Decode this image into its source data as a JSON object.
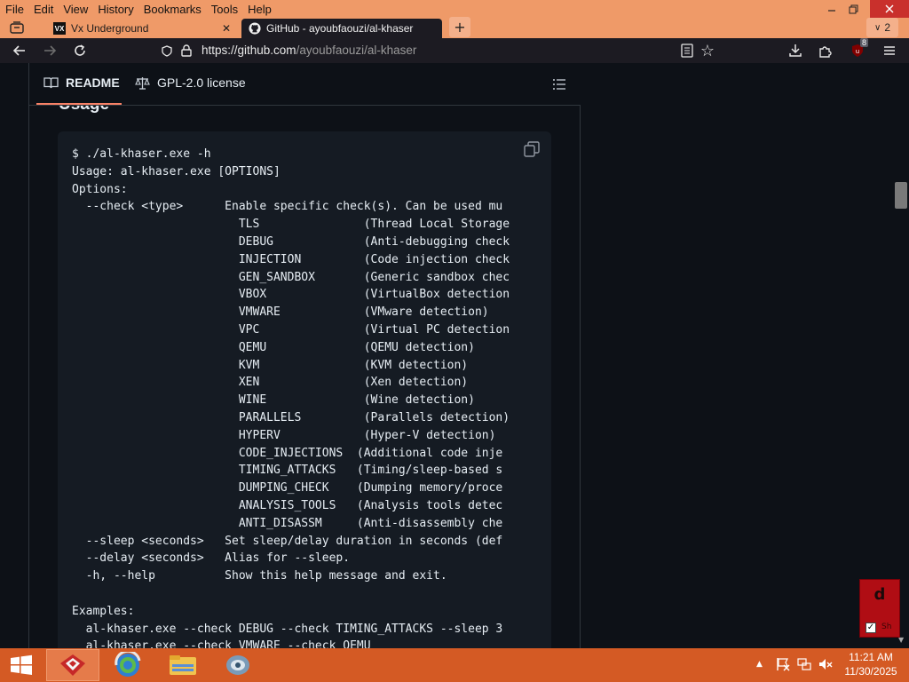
{
  "menu": [
    "File",
    "Edit",
    "View",
    "History",
    "Bookmarks",
    "Tools",
    "Help"
  ],
  "tabs": [
    {
      "title": "Vx Underground",
      "favicon": "VX"
    },
    {
      "title": "GitHub - ayoubfaouzi/al-khaser",
      "favicon": "github-icon"
    }
  ],
  "tab_count": "2",
  "address": {
    "host": "https://github.com",
    "path": "/ayoubfaouzi/al-khaser"
  },
  "extension_badge": "8",
  "readme_tabs": {
    "readme": "README",
    "license": "GPL-2.0 license"
  },
  "section_heading": "Usage",
  "code_lines": [
    "$ ./al-khaser.exe -h",
    "Usage: al-khaser.exe [OPTIONS]",
    "Options:",
    "  --check <type>      Enable specific check(s). Can be used mu",
    "                        TLS               (Thread Local Storage",
    "                        DEBUG             (Anti-debugging check",
    "                        INJECTION         (Code injection check",
    "                        GEN_SANDBOX       (Generic sandbox chec",
    "                        VBOX              (VirtualBox detection",
    "                        VMWARE            (VMware detection)",
    "                        VPC               (Virtual PC detection",
    "                        QEMU              (QEMU detection)",
    "                        KVM               (KVM detection)",
    "                        XEN               (Xen detection)",
    "                        WINE              (Wine detection)",
    "                        PARALLELS         (Parallels detection)",
    "                        HYPERV            (Hyper-V detection)",
    "                        CODE_INJECTIONS  (Additional code inje",
    "                        TIMING_ATTACKS   (Timing/sleep-based s",
    "                        DUMPING_CHECK    (Dumping memory/proce",
    "                        ANALYSIS_TOOLS   (Analysis tools detec",
    "                        ANTI_DISASSM     (Anti-disassembly che",
    "  --sleep <seconds>   Set sleep/delay duration in seconds (def",
    "  --delay <seconds>   Alias for --sleep.",
    "  -h, --help          Show this help message and exit.",
    "",
    "Examples:",
    "  al-khaser.exe --check DEBUG --check TIMING_ATTACKS --sleep 3",
    "  al-khaser.exe --check VMWARE --check QEMU"
  ],
  "widget": {
    "letter": "d",
    "check": "✓",
    "small": "Sh"
  },
  "clock": {
    "time": "11:21 AM",
    "date": "11/30/2025"
  },
  "colors": {
    "menubar": "#ef9a68",
    "taskbar": "#d45a24",
    "page_bg": "#0d1117",
    "code_bg": "#151b23",
    "accent": "#f78166"
  }
}
